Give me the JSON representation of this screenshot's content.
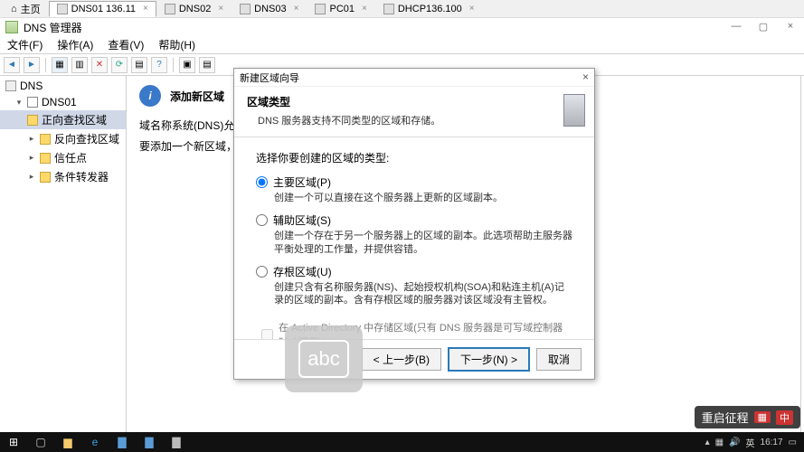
{
  "vm_tabs": {
    "home": "主页",
    "items": [
      {
        "label": "DNS01  136.11",
        "selected": true
      },
      {
        "label": "DNS02"
      },
      {
        "label": "DNS03"
      },
      {
        "label": "PC01"
      },
      {
        "label": "DHCP136.100"
      }
    ]
  },
  "mmc": {
    "title": "DNS 管理器",
    "menu": [
      "文件(F)",
      "操作(A)",
      "查看(V)",
      "帮助(H)"
    ]
  },
  "tree": {
    "root": "DNS",
    "server": "DNS01",
    "folders": [
      {
        "label": "正向查找区域",
        "selected": true
      },
      {
        "label": "反向查找区域"
      },
      {
        "label": "信任点"
      },
      {
        "label": "条件转发器"
      }
    ]
  },
  "content": {
    "heading": "添加新区域",
    "p1": "域名称系统(DNS)允许将 DN",
    "p2": "要添加一个新区域，请在\"操"
  },
  "wizard": {
    "title": "新建区域向导",
    "header": "区域类型",
    "header_sub": "DNS 服务器支持不同类型的区域和存储。",
    "prompt": "选择你要创建的区域的类型:",
    "options": [
      {
        "label": "主要区域(P)",
        "desc": "创建一个可以直接在这个服务器上更新的区域副本。",
        "checked": true
      },
      {
        "label": "辅助区域(S)",
        "desc": "创建一个存在于另一个服务器上的区域的副本。此选项帮助主服务器平衡处理的工作量，并提供容错。"
      },
      {
        "label": "存根区域(U)",
        "desc": "创建只含有名称服务器(NS)、起始授权机构(SOA)和粘连主机(A)记录的区域的副本。含有存根区域的服务器对该区域没有主管权。"
      }
    ],
    "ad_check": "在 Active Directory 中存储区域(只有 DNS 服务器是可写域控制器时才可用)(A)",
    "buttons": {
      "back": "< 上一步(B)",
      "next": "下一步(N) >",
      "cancel": "取消"
    }
  },
  "ime": "abc",
  "watermark": {
    "text": "重启征程",
    "badge": "中"
  },
  "clock": "16:17"
}
